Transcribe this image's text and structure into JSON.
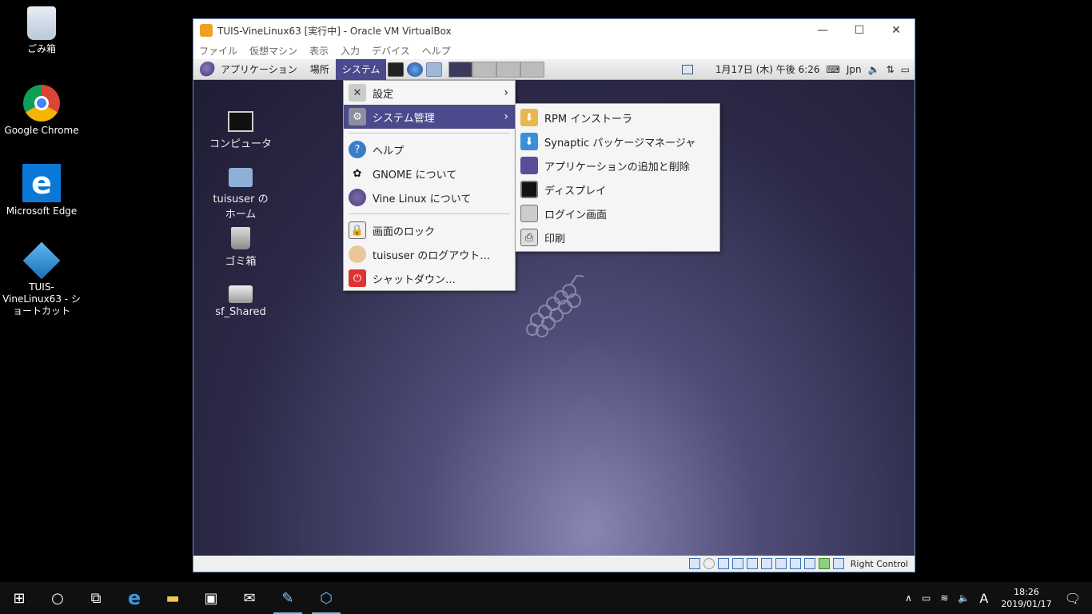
{
  "desktop": {
    "icons": [
      {
        "label": "ごみ箱"
      },
      {
        "label": "Google Chrome"
      },
      {
        "label": "Microsoft Edge"
      },
      {
        "label": "TUIS-VineLinux63 - ショートカット"
      }
    ]
  },
  "vbox": {
    "title": "TUIS-VineLinux63 [実行中] - Oracle VM VirtualBox",
    "menu": [
      "ファイル",
      "仮想マシン",
      "表示",
      "入力",
      "デバイス",
      "ヘルプ"
    ],
    "status_host_key": "Right Control"
  },
  "guest": {
    "panel": {
      "applications": "アプリケーション",
      "places": "場所",
      "system": "システム",
      "datetime": "1月17日 (木) 午後 6:26",
      "keyboard": "Jpn"
    },
    "desktop_icons": [
      {
        "label": "コンピュータ"
      },
      {
        "label": "tuisuser の\nホーム"
      },
      {
        "label": "ゴミ箱"
      },
      {
        "label": "sf_Shared"
      }
    ],
    "system_menu": {
      "settings": "設定",
      "admin": "システム管理",
      "help": "ヘルプ",
      "about_gnome": "GNOME について",
      "about_vine": "Vine Linux について",
      "lock": "画面のロック",
      "logout": "tuisuser のログアウト…",
      "shutdown": "シャットダウン…"
    },
    "admin_submenu": [
      {
        "label": "RPM インストーラ",
        "icon": "package-install-icon"
      },
      {
        "label": "Synaptic パッケージマネージャ",
        "icon": "synaptic-icon"
      },
      {
        "label": "アプリケーションの追加と削除",
        "icon": "add-remove-icon"
      },
      {
        "label": "ディスプレイ",
        "icon": "display-icon"
      },
      {
        "label": "ログイン画面",
        "icon": "login-screen-icon"
      },
      {
        "label": "印刷",
        "icon": "printer-icon"
      }
    ]
  },
  "taskbar": {
    "ime": "A",
    "time": "18:26",
    "date": "2019/01/17"
  }
}
